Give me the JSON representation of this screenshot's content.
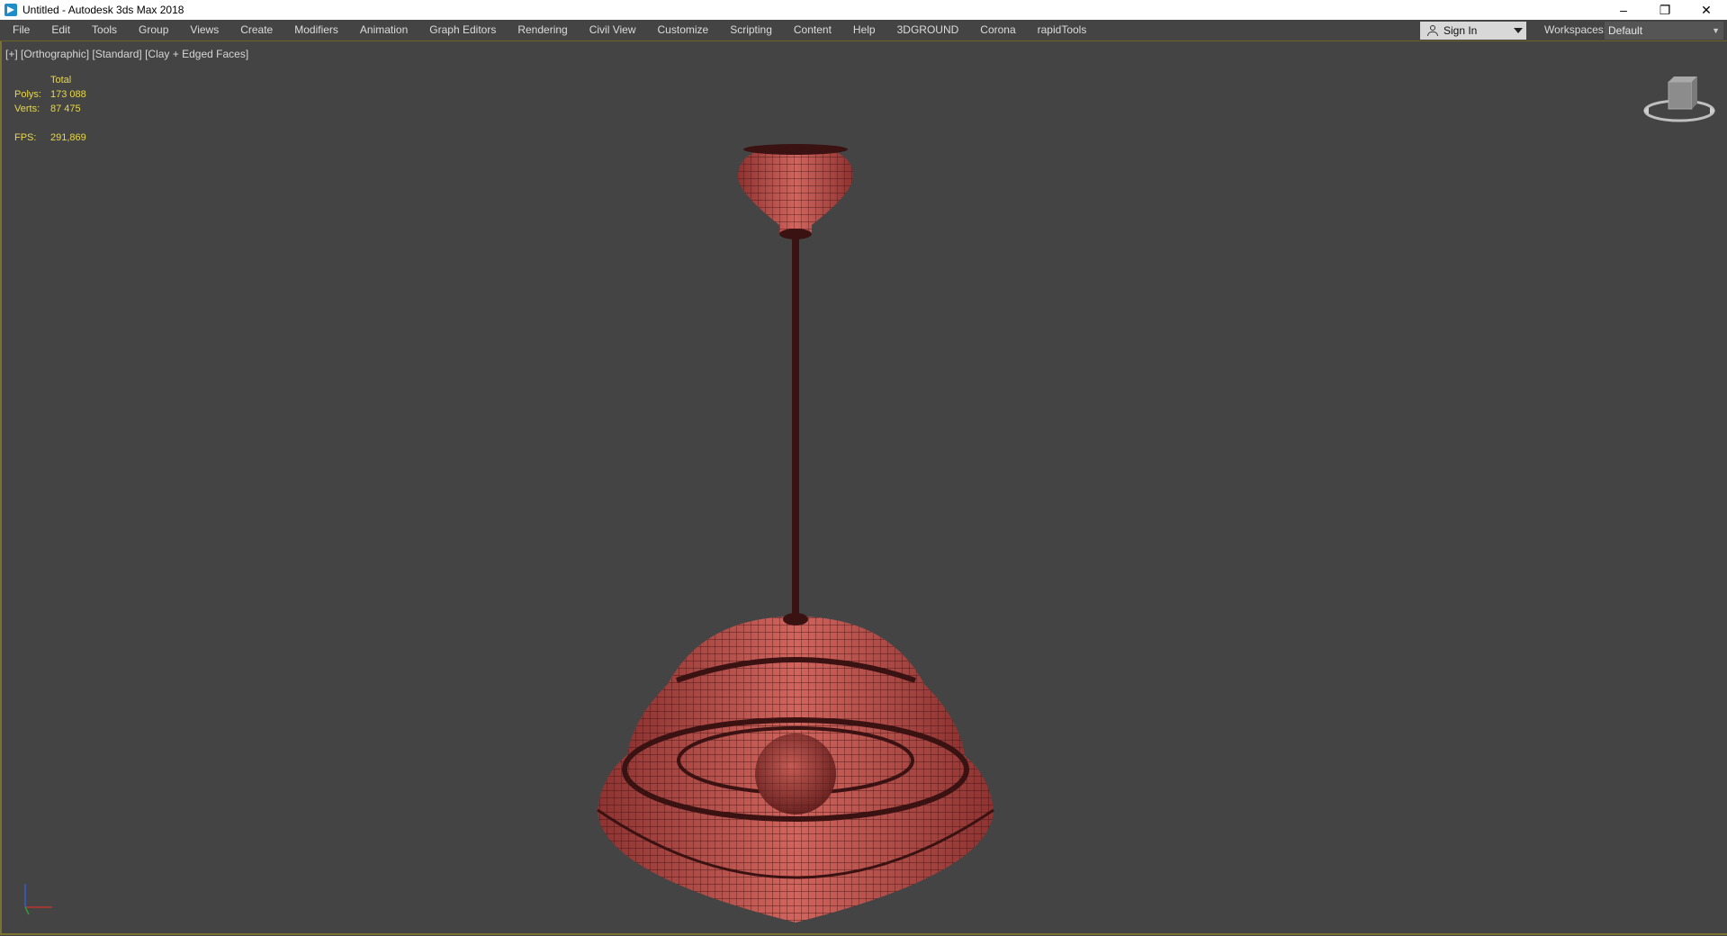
{
  "window": {
    "title": "Untitled - Autodesk 3ds Max 2018",
    "controls": {
      "minimize": "–",
      "restore": "❐",
      "close": "✕"
    }
  },
  "menu": {
    "items": [
      "File",
      "Edit",
      "Tools",
      "Group",
      "Views",
      "Create",
      "Modifiers",
      "Animation",
      "Graph Editors",
      "Rendering",
      "Civil View",
      "Customize",
      "Scripting",
      "Content",
      "Help",
      "3DGROUND",
      "Corona",
      "rapidTools"
    ]
  },
  "account": {
    "sign_in": "Sign In"
  },
  "workspaces": {
    "label": "Workspaces:",
    "value": "Default"
  },
  "viewport": {
    "label": "[+] [Orthographic] [Standard] [Clay + Edged Faces]",
    "stats": {
      "header": "Total",
      "polys_label": "Polys:",
      "polys": "173 088",
      "verts_label": "Verts:",
      "verts": "87 475",
      "fps_label": "FPS:",
      "fps": "291,869"
    },
    "mesh_color": "#c0504a",
    "wire_color": "#3b1212"
  }
}
